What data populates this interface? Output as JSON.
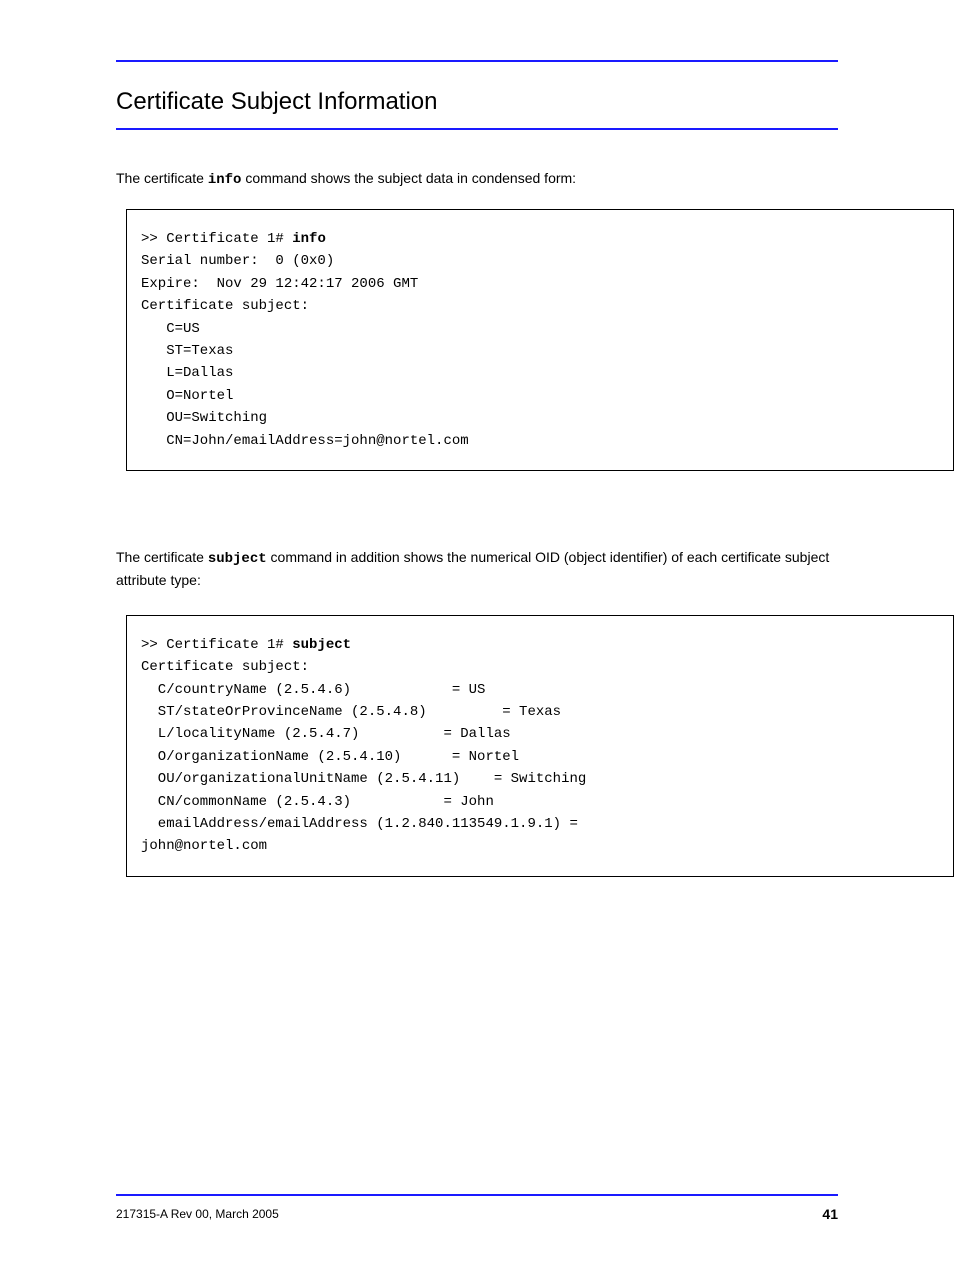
{
  "title": "Certificate Subject Information",
  "para1_prefix": "The certificate ",
  "para1_cmd": "info",
  "para1_suffix": " command shows the subject data in condensed form:",
  "codebox1_prompt": ">> Certificate 1# ",
  "codebox1_cmd": "info",
  "codebox1_body": "Serial number:  0 (0x0)\nExpire:  Nov 29 12:42:17 2006 GMT\nCertificate subject:\n   C=US\n   ST=Texas\n   L=Dallas\n   O=Nortel\n   OU=Switching\n   CN=John/emailAddress=john@nortel.com",
  "para2_prefix": "The certificate ",
  "para2_cmd": "subject",
  "para2_suffix": " command in addition shows the numerical OID (object identifier) of each certificate subject attribute type:",
  "codebox2_prompt": ">> Certificate 1# ",
  "codebox2_cmd": "subject",
  "codebox2_body": "Certificate subject:\n  C/countryName (2.5.4.6)            = US\n  ST/stateOrProvinceName (2.5.4.8)         = Texas\n  L/localityName (2.5.4.7)          = Dallas\n  O/organizationName (2.5.4.10)      = Nortel\n  OU/organizationalUnitName (2.5.4.11)    = Switching\n  CN/commonName (2.5.4.3)           = John\n  emailAddress/emailAddress (1.2.840.113549.1.9.1) =\njohn@nortel.com",
  "footer_doc": "217315-A Rev 00, March 2005",
  "footer_page": "41"
}
